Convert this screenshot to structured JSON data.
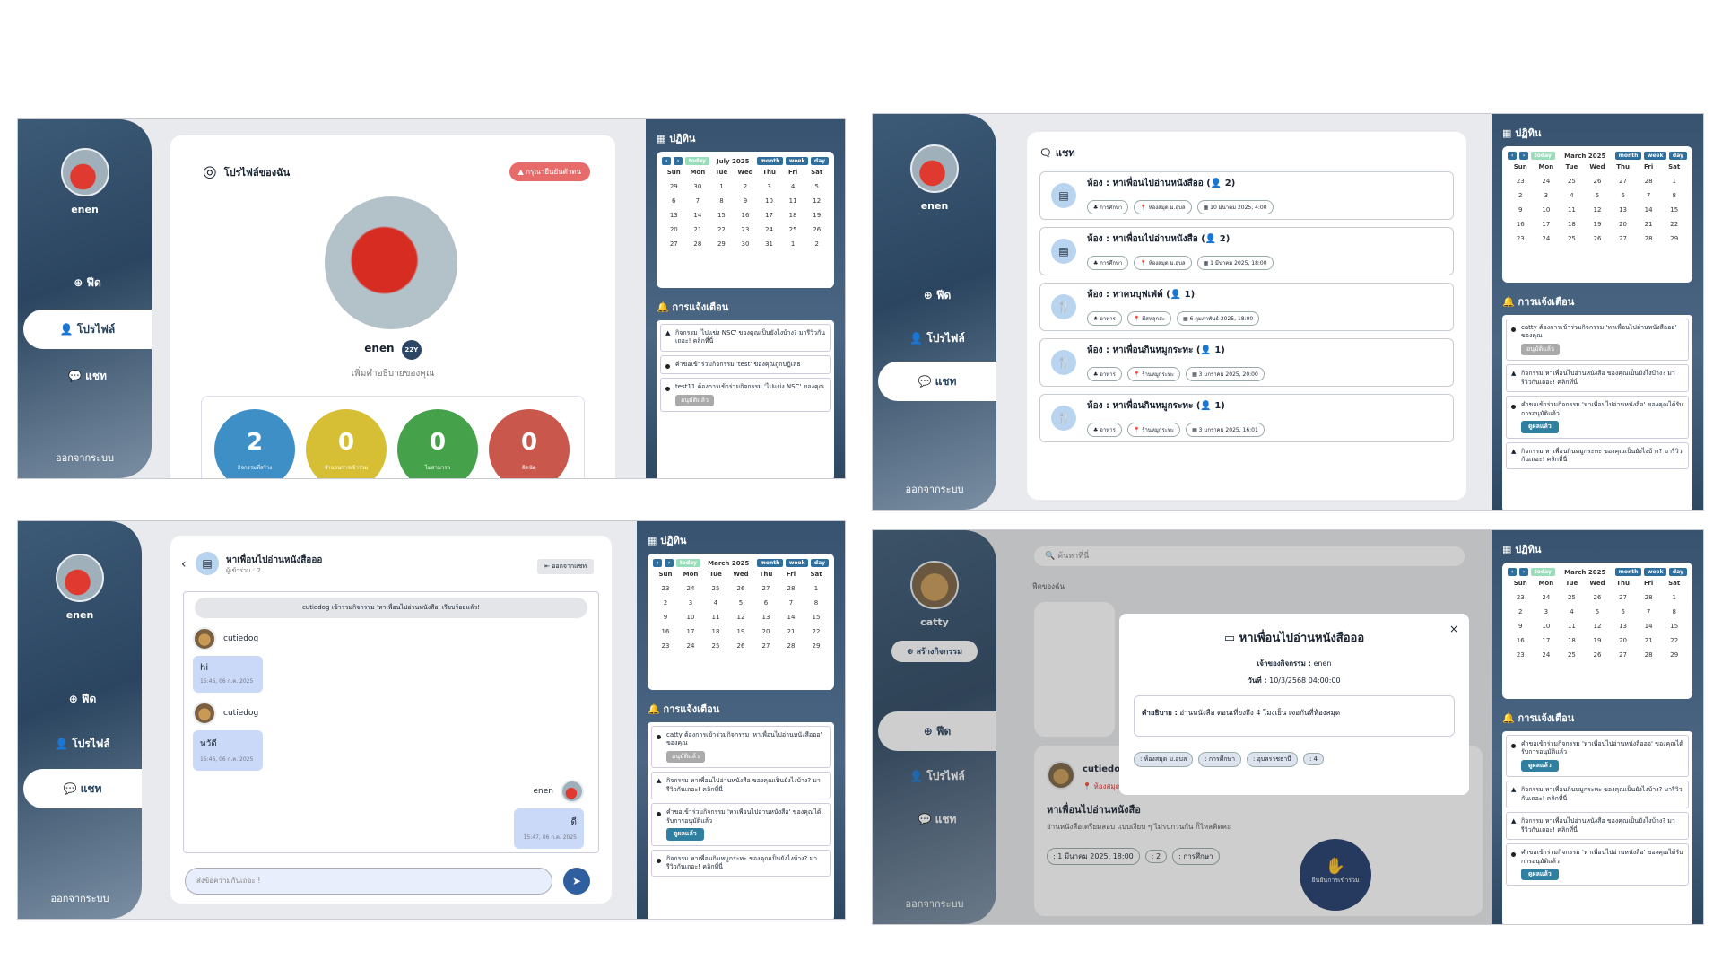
{
  "user": {
    "name": "enen",
    "age": "22Y",
    "desc": "เพิ่มคำอธิบายของคุณ"
  },
  "nav": {
    "feed": "ฟีด",
    "profile": "โปรไฟล์",
    "chat": "แชท",
    "logout": "ออกจากระบบ",
    "create": "สร้างกิจกรรม"
  },
  "calendar": {
    "title": "ปฏิทิน",
    "month_july": "July 2025",
    "month_march": "March 2025",
    "today": "today",
    "buttons": [
      "month",
      "week",
      "day"
    ],
    "days": [
      "Sun",
      "Mon",
      "Tue",
      "Wed",
      "Thu",
      "Fri",
      "Sat"
    ]
  },
  "notif": {
    "title": "การแจ้งเตือน",
    "approved": "อนุมัติแล้ว",
    "view": "ดูผลแล้ว"
  },
  "p1": {
    "title": "โปรไฟล์ของฉัน",
    "alert": "กรุณายืนยันตัวตน",
    "stats": [
      {
        "v": "2",
        "l": "กิจกรรมที่สร้าง",
        "c": "#3d8fc6"
      },
      {
        "v": "0",
        "l": "จำนวนการเข้าร่วม",
        "c": "#d6bf34"
      },
      {
        "v": "0",
        "l": "ไม่สามารถ",
        "c": "#46a24a"
      },
      {
        "v": "0",
        "l": "ผิดนัด",
        "c": "#c9574b"
      }
    ],
    "notifs": [
      "กิจกรรม 'ไปแข่ง NSC' ของคุณเป็นยังไงบ้าง? มารีวิวกันเถอะ! คลิกที่นี่",
      "คำขอเข้าร่วมกิจกรรม 'test' ของคุณถูกปฏิเสธ",
      "test11 ต้องการเข้าร่วมกิจกรรม 'ไปแข่ง NSC' ของคุณ"
    ]
  },
  "p2": {
    "title": "แชท",
    "rooms": [
      {
        "n": "ห้อง : หาเพื่อนไปอ่านหนังสืออ",
        "c": "2",
        "t": "การศึกษา",
        "p": "ห้องสมุด ม.อุบล",
        "d": "10 มีนาคม 2025, 4:00",
        "i": "▤"
      },
      {
        "n": "ห้อง : หาเพื่อนไปอ่านหนังสือ",
        "c": "2",
        "t": "การศึกษา",
        "p": "ห้องสมุด ม.อุบล",
        "d": "1 มีนาคม 2025, 18:00",
        "i": "▤"
      },
      {
        "n": "ห้อง : หาคนบุฟเฟ่ต์",
        "c": "1",
        "t": "อาหาร",
        "p": "มีสหลุกสะ",
        "d": "6 กุมภาพันธ์ 2025, 18:00",
        "i": "🍴"
      },
      {
        "n": "ห้อง : หาเพื่อนกินหมูกระทะ",
        "c": "1",
        "t": "อาหาร",
        "p": "ร้านหมูกระทะ",
        "d": "3 มกราคม 2025, 20:00",
        "i": "🍴"
      },
      {
        "n": "ห้อง : หาเพื่อนกินหมูกระทะ",
        "c": "1",
        "t": "อาหาร",
        "p": "ร้านหมูกระทะ",
        "d": "3 มกราคม 2025, 16:01",
        "i": "🍴"
      }
    ],
    "notifs": [
      "catty ต้องการเข้าร่วมกิจกรรม 'หาเพื่อนไปอ่านหนังสือออ' ของคุณ",
      "กิจกรรม หาเพื่อนไปอ่านหนังสือ ของคุณเป็นยังไงบ้าง? มารีวิวกันเถอะ! คลิกที่นี่",
      "คำขอเข้าร่วมกิจกรรม 'หาเพื่อนไปอ่านหนังสือ' ของคุณได้รับการอนุมัติแล้ว",
      "กิจกรรม หาเพื่อนกินหมูกระทะ ของคุณเป็นยังไงบ้าง? มารีวิวกันเถอะ! คลิกที่นี่"
    ]
  },
  "p3": {
    "room": "หาเพื่อนไปอ่านหนังสือออ",
    "members": "ผู้เข้าร่วม : 2",
    "leave": "ออกจากแชท",
    "sys": "cutiedog เข้าร่วมกิจกรรม 'หาเพื่อนไปอ่านหนังสือ' เรียบร้อยแล้ว!",
    "sender": "cutiedog",
    "m1": "hi",
    "t1": "15:46, 06 ก.ค. 2025",
    "m2": "หวัดี",
    "t2": "15:46, 06 ก.ค. 2025",
    "me": "enen",
    "m3": "ดี",
    "t3": "15:47, 06 ก.ค. 2025",
    "placeholder": "ส่งข้อความกันเถอะ !"
  },
  "p4": {
    "user": "catty",
    "search": "ค้นหาที่นี่",
    "feedlbl": "ฟีดของฉัน",
    "modal": {
      "title": "หาเพื่อนไปอ่านหนังสือออ",
      "host_l": "เจ้าของกิจกรรม :",
      "host": "enen",
      "date_l": "วันที่ :",
      "date": "10/3/2568 04:00:00",
      "desc_l": "คำอธิบาย :",
      "desc": "อ่านหนังสือ ตอนเที่ยงถึง 4 โมงเย็น เจอกันที่ห้องสมุด",
      "chips": [
        ": ห้องสมุด ม.อุบล",
        ": การศึกษา",
        ": อุบลราชธานี",
        ": 4"
      ],
      "close": "×"
    },
    "post": {
      "user": "cutiedog",
      "place": "ห้องสมุด ม.อุบล",
      "title": "หาเพื่อนไปอ่านหนังสือ",
      "desc": "อ่านหนังสือเตรียมสอบ แบบเงียบ ๆ ไม่รบกวนกัน ก็ไหลคิดคะ",
      "date": ": 1 มีนาคม 2025, 18:00",
      "cnt": ": 2",
      "cat": ": การศึกษา",
      "join": "ยืนยันการเข้าร่วม"
    },
    "notifs": [
      "คำขอเข้าร่วมกิจกรรม 'หาเพื่อนไปอ่านหนังสือออ' ของคุณได้รับการอนุมัติแล้ว",
      "กิจกรรม หาเพื่อนกินหมูกระทะ ของคุณเป็นยังไงบ้าง? มารีวิวกันเถอะ! คลิกที่นี่",
      "กิจกรรม หาเพื่อนไปอ่านหนังสือ ของคุณเป็นยังไงบ้าง? มารีวิวกันเถอะ! คลิกที่นี่",
      "คำขอเข้าร่วมกิจกรรม 'หาเพื่อนไปอ่านหนังสือ' ของคุณได้รับการอนุมัติแล้ว"
    ]
  },
  "julyWeeks": [
    [
      "29",
      "30",
      "1",
      "2",
      "3",
      "4",
      "5"
    ],
    [
      "6",
      "7",
      "8",
      "9",
      "10",
      "11",
      "12"
    ],
    [
      "13",
      "14",
      "15",
      "16",
      "17",
      "18",
      "19"
    ],
    [
      "20",
      "21",
      "22",
      "23",
      "24",
      "25",
      "26"
    ],
    [
      "27",
      "28",
      "29",
      "30",
      "31",
      "1",
      "2"
    ]
  ],
  "marchWeeks": [
    [
      "23",
      "24",
      "25",
      "26",
      "27",
      "28",
      "1"
    ],
    [
      "2",
      "3",
      "4",
      "5",
      "6",
      "7",
      "8"
    ],
    [
      "9",
      "10",
      "11",
      "12",
      "13",
      "14",
      "15"
    ],
    [
      "16",
      "17",
      "18",
      "19",
      "20",
      "21",
      "22"
    ],
    [
      "23",
      "24",
      "25",
      "26",
      "27",
      "28",
      "29"
    ]
  ]
}
